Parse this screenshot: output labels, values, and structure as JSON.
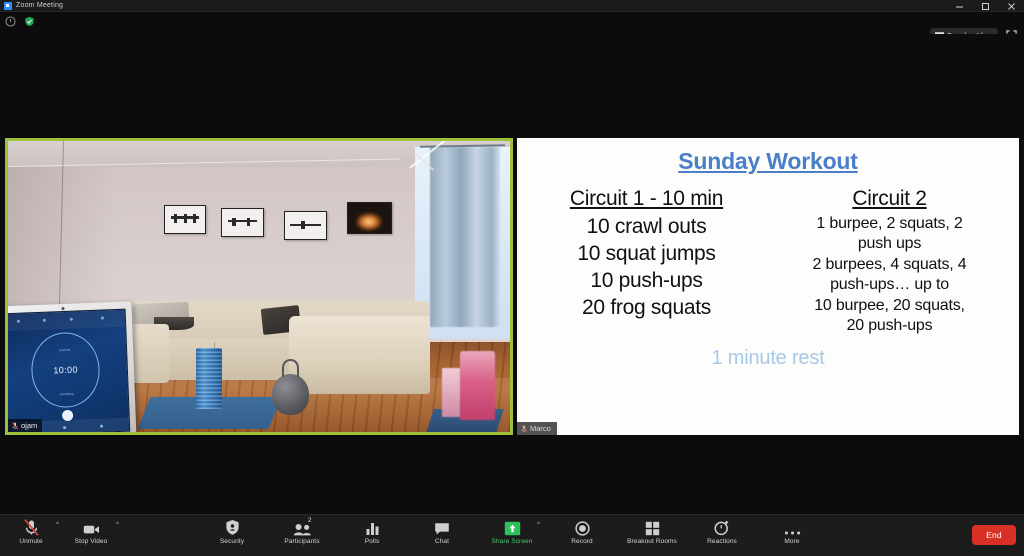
{
  "window": {
    "title": "Zoom Meeting",
    "app_icon": "zoom-logo-icon",
    "minimize": "minimize-icon",
    "maximize": "maximize-icon",
    "close": "close-icon"
  },
  "status": {
    "recording_icon": "record-info-icon",
    "encryption_icon": "green-shield-icon",
    "view_button": "Speaker View",
    "view_icon": "grid-view-icon",
    "fullscreen_icon": "enter-fullscreen-icon"
  },
  "video_tile": {
    "participant_name": "ojam",
    "mic_icon": "mic-muted-icon",
    "active_speaker_border_color": "#9ec13c",
    "timer_display": "10:00",
    "timer_label_top": "workout",
    "timer_label_bottom": "remaining"
  },
  "shared_screen": {
    "presenter_name": "Marco",
    "mic_icon": "mic-muted-icon",
    "title": "Sunday Workout",
    "title_color": "#4a7ec8",
    "rest_note": "1 minute rest",
    "rest_note_color": "#a8c8e8",
    "columns": [
      {
        "heading": "Circuit 1 - 10 min",
        "lines": [
          "10 crawl outs",
          "10 squat jumps",
          "10 push-ups",
          "20 frog squats"
        ]
      },
      {
        "heading": "Circuit 2",
        "lines": [
          "1 burpee, 2 squats, 2",
          "push ups",
          "2 burpees, 4 squats, 4",
          "push-ups… up to",
          "10 burpee, 20 squats,",
          "20 push-ups"
        ]
      }
    ]
  },
  "toolbar": {
    "left": [
      {
        "label": "Unmute",
        "icon": "mic-muted-icon",
        "caret": true
      },
      {
        "label": "Stop Video",
        "icon": "video-camera-icon",
        "caret": true
      }
    ],
    "center": [
      {
        "label": "Security",
        "icon": "shield-icon",
        "badge": ""
      },
      {
        "label": "Participants",
        "icon": "participants-icon",
        "badge": "2"
      },
      {
        "label": "Polls",
        "icon": "polls-bar-icon",
        "badge": ""
      },
      {
        "label": "Chat",
        "icon": "chat-bubble-icon",
        "badge": ""
      },
      {
        "label": "Share Screen",
        "icon": "share-screen-icon",
        "badge": "",
        "active": true,
        "caret": true
      },
      {
        "label": "Record",
        "icon": "record-circle-icon",
        "badge": ""
      },
      {
        "label": "Breakout Rooms",
        "icon": "breakout-grid-icon",
        "badge": ""
      },
      {
        "label": "Reactions",
        "icon": "reactions-clock-icon",
        "badge": ""
      },
      {
        "label": "More",
        "icon": "more-ellipsis-icon",
        "badge": ""
      }
    ],
    "end_button": "End",
    "end_button_color": "#d93025"
  }
}
